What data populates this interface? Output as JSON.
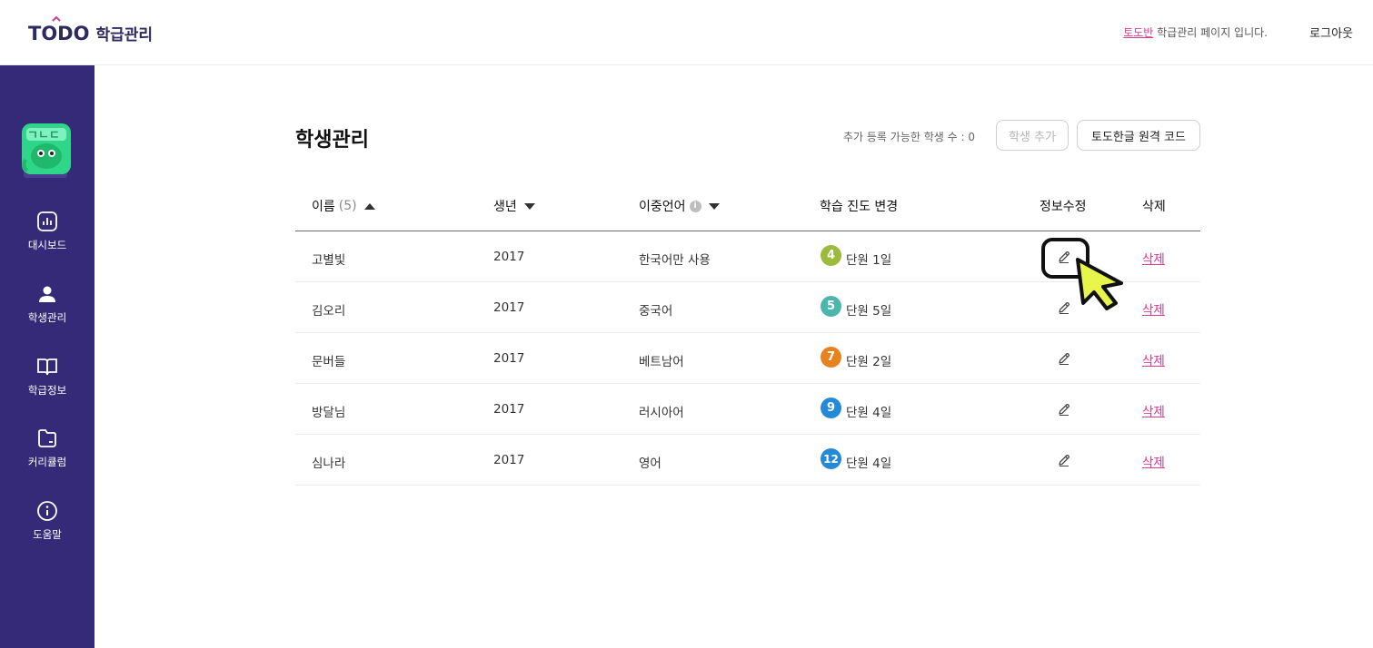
{
  "header": {
    "logo_text": "TODO",
    "logo_sub": "학급관리",
    "class_name": "토도반",
    "page_notice": " 학급관리 페이지 입니다.",
    "logout_label": "로그아웃"
  },
  "sidebar": {
    "items": [
      {
        "label": "대시보드",
        "icon": "chart-icon"
      },
      {
        "label": "학생관리",
        "icon": "user-icon"
      },
      {
        "label": "학급정보",
        "icon": "book-icon"
      },
      {
        "label": "커리큘럼",
        "icon": "folder-icon"
      },
      {
        "label": "도움말",
        "icon": "info-icon"
      }
    ]
  },
  "main": {
    "title": "학생관리",
    "available_count_text": "추가 등록 가능한 학생 수 : 0",
    "add_student_label": "학생 추가",
    "remote_code_label": "토도한글 원격 코드"
  },
  "table": {
    "headers": {
      "name": "이름",
      "name_count": "(5)",
      "birth_year": "생년",
      "bilingual": "이중언어",
      "progress": "학습 진도 변경",
      "edit": "정보수정",
      "delete": "삭제"
    },
    "rows": [
      {
        "name": "고별빛",
        "year": "2017",
        "language": "한국어만 사용",
        "unit": "4",
        "unit_color": "#9dbb3a",
        "progress": "단원 1일",
        "delete": "삭제"
      },
      {
        "name": "김오리",
        "year": "2017",
        "language": "중국어",
        "unit": "5",
        "unit_color": "#4db6ac",
        "progress": "단원 5일",
        "delete": "삭제"
      },
      {
        "name": "문버들",
        "year": "2017",
        "language": "베트남어",
        "unit": "7",
        "unit_color": "#e8821e",
        "progress": "단원 2일",
        "delete": "삭제"
      },
      {
        "name": "방달님",
        "year": "2017",
        "language": "러시아어",
        "unit": "9",
        "unit_color": "#2389d8",
        "progress": "단원 4일",
        "delete": "삭제"
      },
      {
        "name": "심나라",
        "year": "2017",
        "language": "영어",
        "unit": "12",
        "unit_color": "#2389d8",
        "progress": "단원 4일",
        "delete": "삭제"
      }
    ]
  },
  "colors": {
    "sidebar_bg": "#352a77",
    "accent_pink": "#d63c8f",
    "cursor_yellow": "#e8f54a"
  }
}
